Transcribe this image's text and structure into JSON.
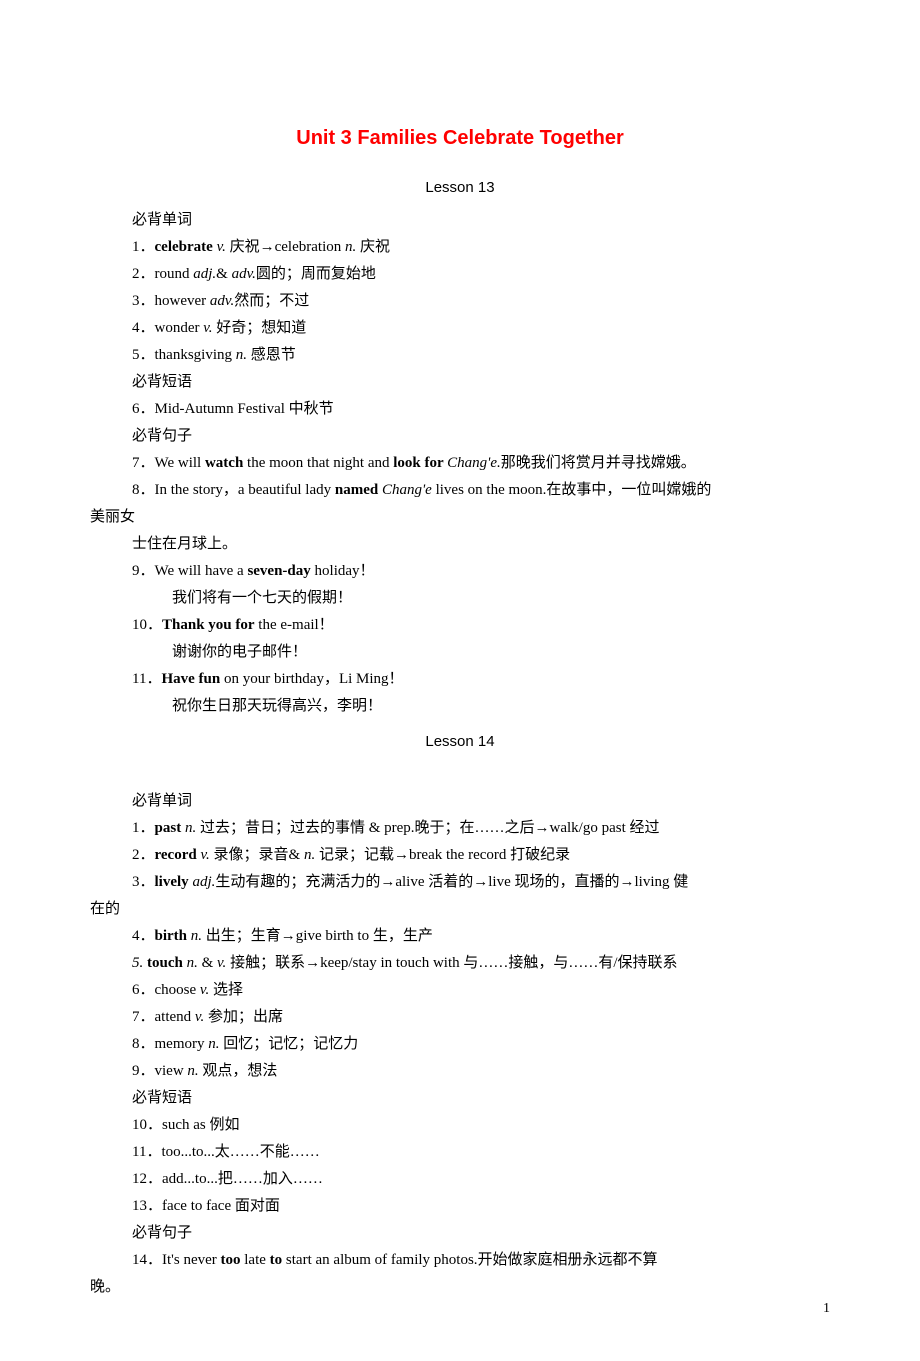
{
  "title": "Unit 3 Families Celebrate Together",
  "lesson13": {
    "header": "Lesson 13",
    "sec_vocab": "必背单词",
    "l1_a": "1．",
    "l1_b": "celebrate ",
    "l1_c": "v. ",
    "l1_d": "庆祝→celebration ",
    "l1_e": "n. ",
    "l1_f": "庆祝",
    "l2_a": "2．round ",
    "l2_b": "adj.",
    "l2_c": "& ",
    "l2_d": "adv.",
    "l2_e": "圆的；周而复始地",
    "l3_a": "3．however  ",
    "l3_b": "adv.",
    "l3_c": "然而；不过",
    "l4_a": "4．wonder ",
    "l4_b": "v. ",
    "l4_c": "好奇；想知道",
    "l5_a": "5．thanksgiving ",
    "l5_b": "n. ",
    "l5_c": "感恩节",
    "sec_phrase": "必背短语",
    "l6": "6．Mid-Autumn Festival 中秋节",
    "sec_sent": "必背句子",
    "l7_a": "7．We will ",
    "l7_b": "watch",
    "l7_c": " the moon that night and ",
    "l7_d": "look for ",
    "l7_e": "Chang'e.",
    "l7_f": "那晚我们将赏月并寻找嫦娥。",
    "l8_a": "8．In the story，a beautiful lady ",
    "l8_b": "named ",
    "l8_c": "Chang'e",
    "l8_d": " lives on the moon.在故事中，一位叫嫦娥的",
    "l8_wrap": "美丽女",
    "l8_cont": "士住在月球上。",
    "l9_a": "9．We will have a ",
    "l9_b": "seven-day",
    "l9_c": " holiday！",
    "l9_cn": "我们将有一个七天的假期！",
    "l10_a": "10．",
    "l10_b": "Thank you for",
    "l10_c": " the e-mail！",
    "l10_cn": "谢谢你的电子邮件！",
    "l11_a": "11．",
    "l11_b": "Have fun",
    "l11_c": " on your birthday，Li Ming！",
    "l11_cn": "祝你生日那天玩得高兴，李明！"
  },
  "lesson14": {
    "header": "Lesson 14",
    "sec_vocab": "必背单词",
    "l1_a": "1．",
    "l1_b": "past ",
    "l1_c": "n. ",
    "l1_d": "过去；昔日；过去的事情 & prep.晚于；在……之后→walk/go past 经过",
    "l2_a": "2．",
    "l2_b": "record ",
    "l2_c": "v. ",
    "l2_d": "录像；录音& ",
    "l2_e": "n. ",
    "l2_f": "记录；记载→break the record 打破纪录",
    "l3_a": "3．",
    "l3_b": "lively ",
    "l3_c": "adj.",
    "l3_d": "生动有趣的；充满活力的→alive 活着的→live 现场的，直播的→living 健",
    "l3_wrap": "在的",
    "l4_a": "4．",
    "l4_b": "birth ",
    "l4_c": "n. ",
    "l4_d": "出生；生育→give birth to 生，生产",
    "l5_a": "5. ",
    "l5_b": "touch ",
    "l5_c": "n. ",
    "l5_d": "& ",
    "l5_e": "v. ",
    "l5_f": "接触；联系→keep/stay in touch with 与……接触，与……有/保持联系",
    "l6_a": "6．choose ",
    "l6_b": "v. ",
    "l6_c": "选择",
    "l7_a": "7．attend ",
    "l7_b": "v. ",
    "l7_c": "参加；出席",
    "l8_a": "8．memory ",
    "l8_b": "n. ",
    "l8_c": "回忆；记忆；记忆力",
    "l9_a": "9．view ",
    "l9_b": "n. ",
    "l9_c": "观点，想法",
    "sec_phrase": "必背短语",
    "l10": "10．such as 例如",
    "l11": "11．too...to...太……不能……",
    "l12": "12．add...to...把……加入……",
    "l13": "13．face to face 面对面",
    "sec_sent": "必背句子",
    "l14_a": "14．It's never ",
    "l14_b": "too",
    "l14_c": " late ",
    "l14_d": "to",
    "l14_e": " start an album of family photos.开始做家庭相册永远都不算",
    "l14_wrap": "晚。"
  },
  "page_num": "1"
}
